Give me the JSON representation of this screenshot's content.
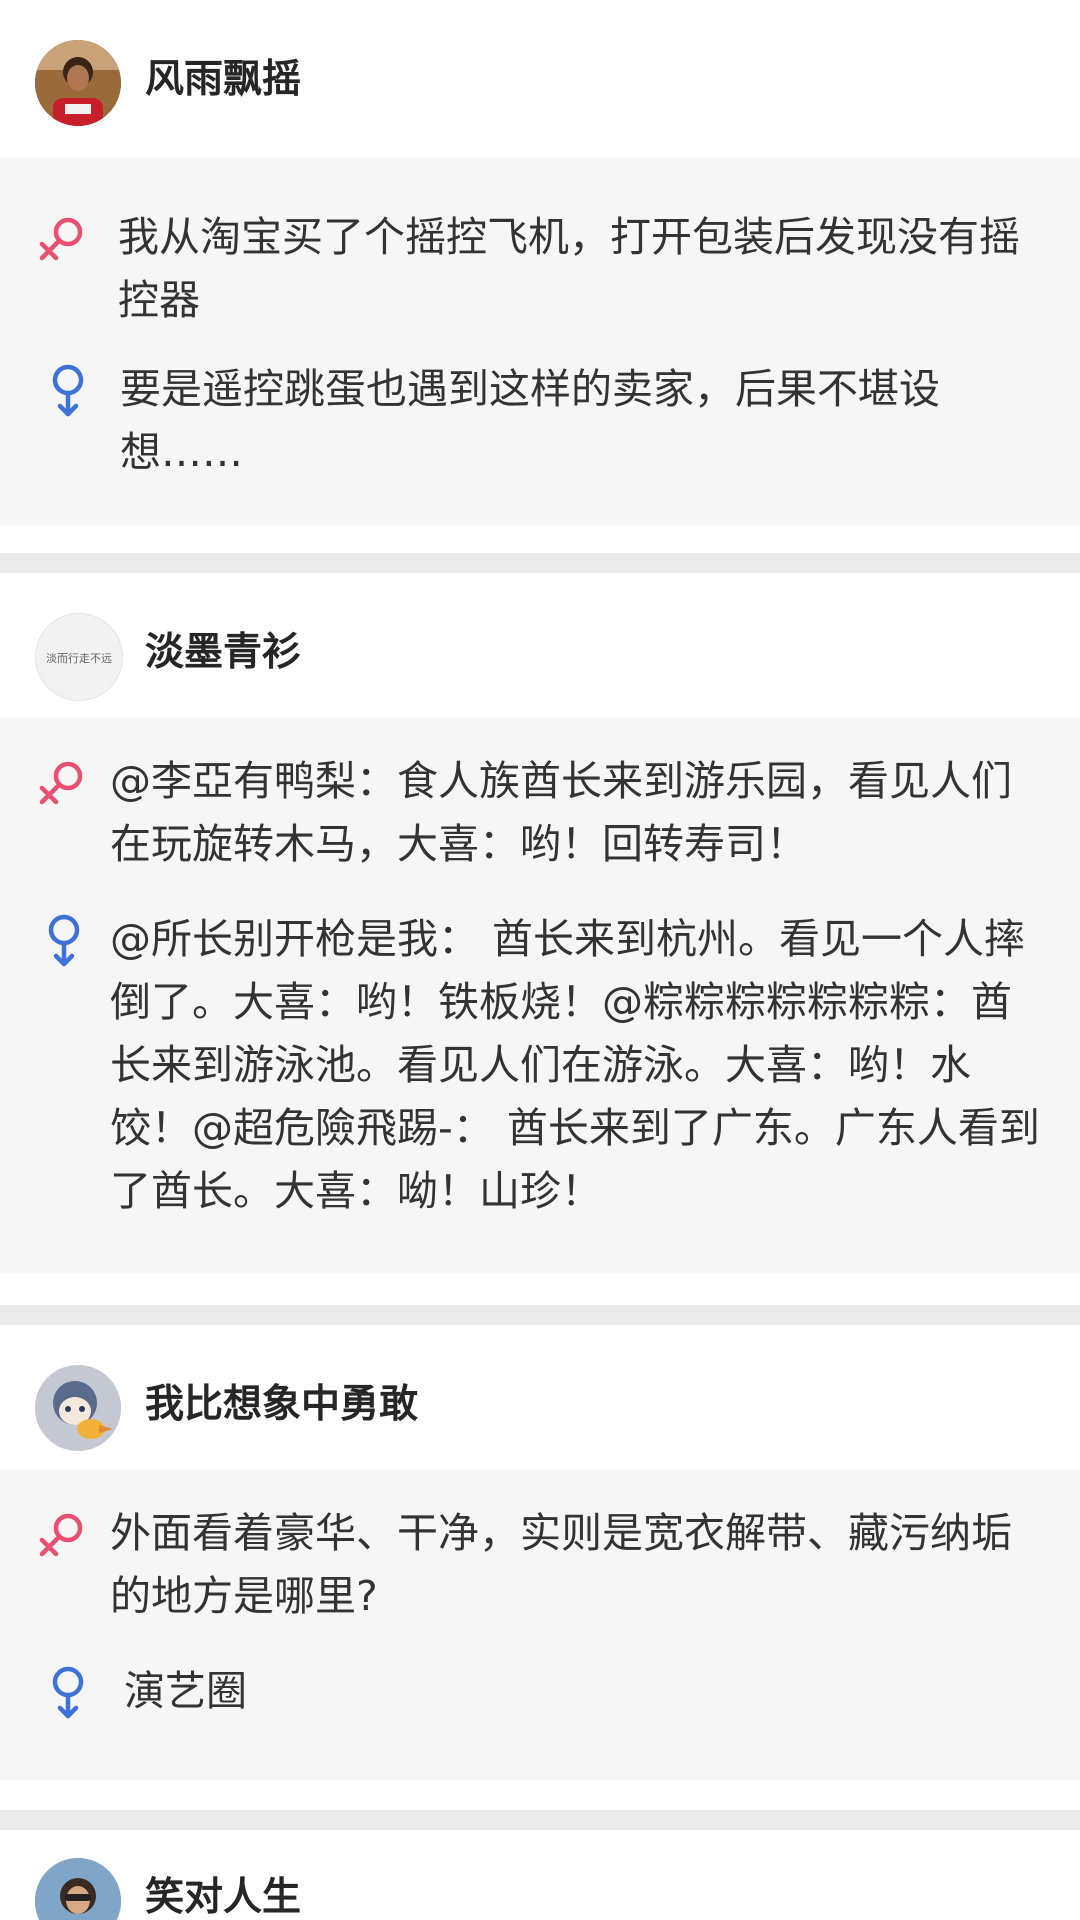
{
  "colors": {
    "female": "#e8506e",
    "male": "#3f72d8"
  },
  "posts": [
    {
      "username": "风雨飘摇",
      "question_icon": "female-symbol-icon",
      "question": "我从淘宝买了个摇控飞机，打开包装后发现没有摇控器",
      "answer_icon": "male-symbol-icon",
      "answer": "要是遥控跳蛋也遇到这样的卖家，后果不堪设想……"
    },
    {
      "username": "淡墨青衫",
      "avatar_text": "淡而行走不远",
      "question_icon": "female-symbol-icon",
      "question": "@李亞有鸭梨：食人族酋长来到游乐园，看见人们在玩旋转木马，大喜：哟！回转寿司！",
      "answer_icon": "male-symbol-icon",
      "answer": "@所长别开枪是我： 酋长来到杭州。看见一个人摔倒了。大喜：哟！铁板烧！@粽粽粽粽粽粽粽：酋长来到游泳池。看见人们在游泳。大喜：哟！水饺！@超危險飛踢-： 酋长来到了广东。广东人看到了酋长。大喜：呦！山珍！"
    },
    {
      "username": "我比想象中勇敢",
      "question_icon": "female-symbol-icon",
      "question": "外面看着豪华、干净，实则是宽衣解带、藏污纳垢的地方是哪里?",
      "answer_icon": "male-symbol-icon",
      "answer": "演艺圈"
    },
    {
      "username": "笑对人生"
    }
  ]
}
